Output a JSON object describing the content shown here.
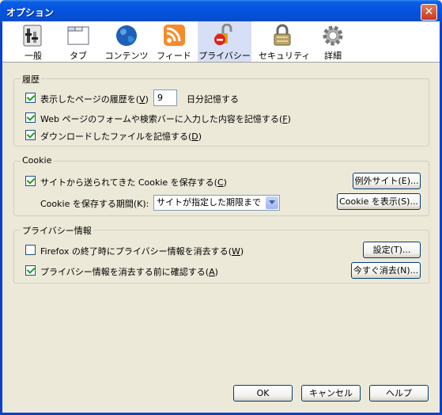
{
  "window": {
    "title": "オプション",
    "close_symbol": "✕"
  },
  "toolbar": [
    {
      "label": "一般",
      "icon": "general-icon"
    },
    {
      "label": "タブ",
      "icon": "tabs-icon"
    },
    {
      "label": "コンテンツ",
      "icon": "content-globe-icon"
    },
    {
      "label": "フィード",
      "icon": "feed-icon"
    },
    {
      "label": "プライバシー",
      "icon": "privacy-lock-icon",
      "selected": true
    },
    {
      "label": "セキュリティ",
      "icon": "security-padlock-icon"
    },
    {
      "label": "詳細",
      "icon": "advanced-gear-icon"
    }
  ],
  "history": {
    "title": "履歴",
    "remember_pages_prefix": "表示したページの履歴を",
    "remember_pages_accel": "V",
    "days_value": "9",
    "days_suffix": "日分記憶する",
    "forms_label": "Web ページのフォームや検索バーに入力した内容を記憶する",
    "forms_accel": "F",
    "downloads_label": "ダウンロードしたファイルを記憶する",
    "downloads_accel": "D"
  },
  "cookie": {
    "title": "Cookie",
    "accept_label": "サイトから送られてきた Cookie を保存する",
    "accept_accel": "C",
    "exceptions_button": "例外サイト(E)...",
    "keep_label": "Cookie を保存する期間(K):",
    "keep_value": "サイトが指定した期限まで",
    "show_cookies_button": "Cookie を表示(S)..."
  },
  "private_data": {
    "title": "プライバシー情報",
    "clear_on_exit_label": "Firefox の終了時にプライバシー情報を消去する",
    "clear_on_exit_accel": "W",
    "settings_button": "設定(T)...",
    "ask_label": "プライバシー情報を消去する前に確認する",
    "ask_accel": "A",
    "clear_now_button": "今すぐ消去(N)..."
  },
  "buttons": {
    "ok": "OK",
    "cancel": "キャンセル",
    "help": "ヘルプ"
  },
  "colors": {
    "titlebar": "#0554e0",
    "selected_pane": "#d6dff5",
    "dialog_bg": "#ece9d8"
  }
}
